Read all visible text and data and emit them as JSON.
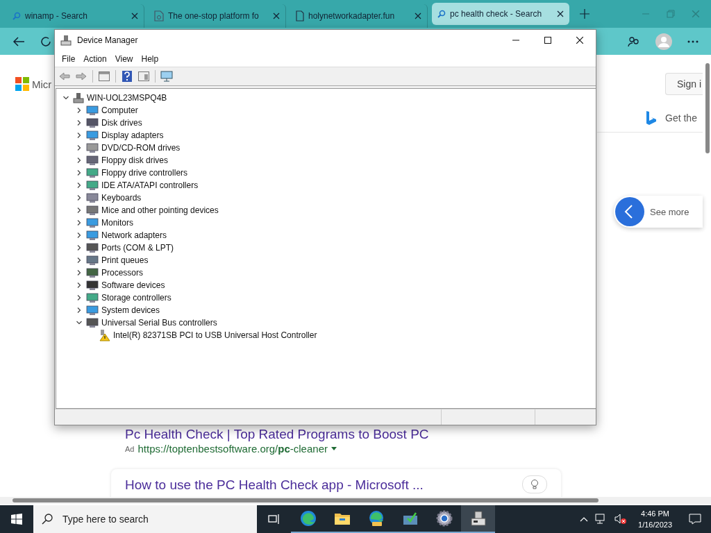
{
  "browser": {
    "tabs": [
      {
        "title": "winamp - Search",
        "kind": "search",
        "selected": false
      },
      {
        "title": "The one-stop platform fo",
        "kind": "page",
        "selected": false
      },
      {
        "title": "holynetworkadapter.fun",
        "kind": "doc",
        "selected": false
      },
      {
        "title": "pc health check - Search",
        "kind": "search",
        "selected": true
      }
    ],
    "page": {
      "logo_text": "Micr",
      "sign_in": "Sign i",
      "get_app": "Get the",
      "see_more": "See more",
      "results": [
        {
          "kind": "ad",
          "title": "Pc Health Check | Top Rated Programs to Boost PC",
          "ad_label": "Ad",
          "url": "https://toptenbestsoftware.org/**pc**-cleaner"
        },
        {
          "kind": "card",
          "title": "How to use the PC Health Check app - Microsoft ..."
        }
      ]
    }
  },
  "device_manager": {
    "title": "Device Manager",
    "menu": [
      "File",
      "Action",
      "View",
      "Help"
    ],
    "tree": {
      "label": "WIN-UOL23MSPQ4B",
      "expanded": true,
      "children": [
        {
          "label": "Computer",
          "expanded": false
        },
        {
          "label": "Disk drives",
          "expanded": false
        },
        {
          "label": "Display adapters",
          "expanded": false
        },
        {
          "label": "DVD/CD-ROM drives",
          "expanded": false
        },
        {
          "label": "Floppy disk drives",
          "expanded": false
        },
        {
          "label": "Floppy drive controllers",
          "expanded": false
        },
        {
          "label": "IDE ATA/ATAPI controllers",
          "expanded": false
        },
        {
          "label": "Keyboards",
          "expanded": false
        },
        {
          "label": "Mice and other pointing devices",
          "expanded": false
        },
        {
          "label": "Monitors",
          "expanded": false
        },
        {
          "label": "Network adapters",
          "expanded": false
        },
        {
          "label": "Ports (COM & LPT)",
          "expanded": false
        },
        {
          "label": "Print queues",
          "expanded": false
        },
        {
          "label": "Processors",
          "expanded": false
        },
        {
          "label": "Software devices",
          "expanded": false
        },
        {
          "label": "Storage controllers",
          "expanded": false
        },
        {
          "label": "System devices",
          "expanded": false
        },
        {
          "label": "Universal Serial Bus controllers",
          "expanded": true,
          "children": [
            {
              "label": "Intel(R) 82371SB PCI to USB Universal Host Controller",
              "warning": true
            }
          ]
        }
      ]
    }
  },
  "taskbar": {
    "search_placeholder": "Type here to search",
    "apps": [
      {
        "kind": "taskview",
        "selected": false
      },
      {
        "kind": "edge",
        "selected": false
      },
      {
        "kind": "folder",
        "selected": false
      },
      {
        "kind": "edgecan",
        "selected": false
      },
      {
        "kind": "app",
        "selected": false
      },
      {
        "kind": "gear",
        "selected": false
      },
      {
        "kind": "devmgr",
        "selected": true
      }
    ],
    "time": "4:46 PM",
    "date": "1/16/2023"
  }
}
